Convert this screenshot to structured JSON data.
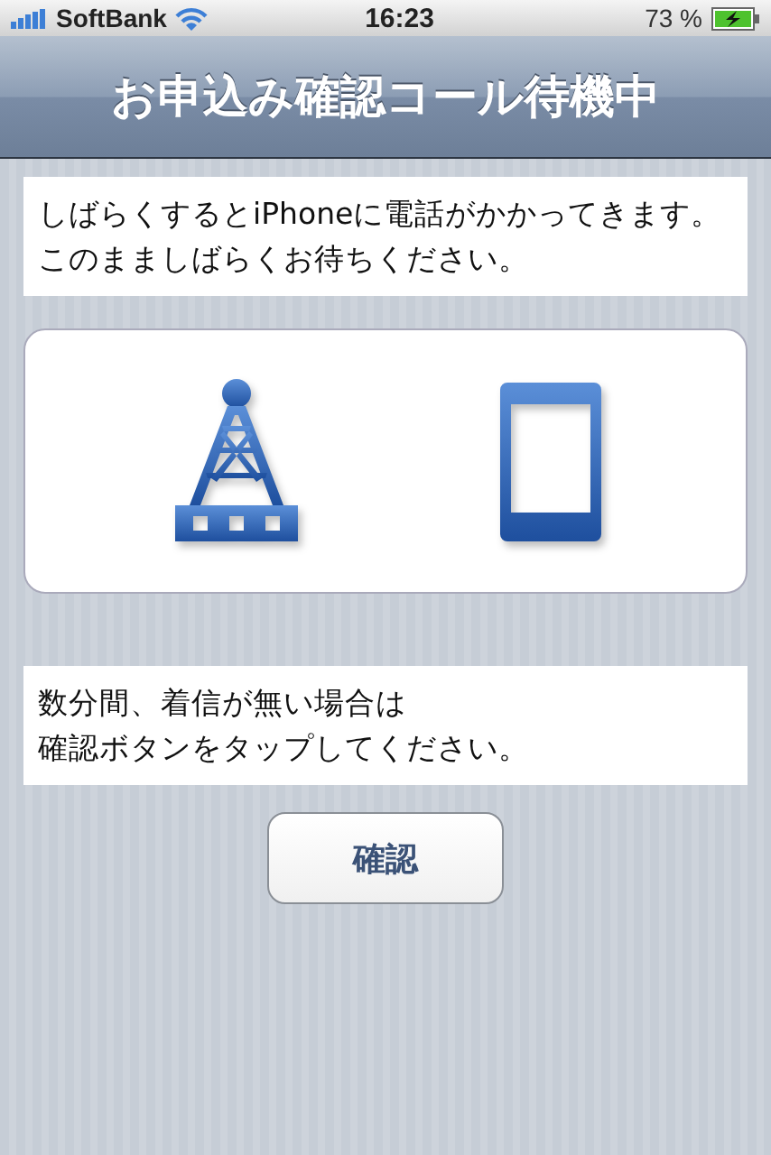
{
  "status_bar": {
    "carrier": "SoftBank",
    "time": "16:23",
    "battery": "73 %",
    "charging": true
  },
  "nav_bar": {
    "title": "お申込み確認コール待機中"
  },
  "message": "しばらくするとiPhoneに電話がかかってきます。このまましばらくお待ちください。",
  "instruction_lines": [
    "数分間、着信が無い場合は",
    "確認ボタンをタップしてください。"
  ],
  "button": "確認"
}
